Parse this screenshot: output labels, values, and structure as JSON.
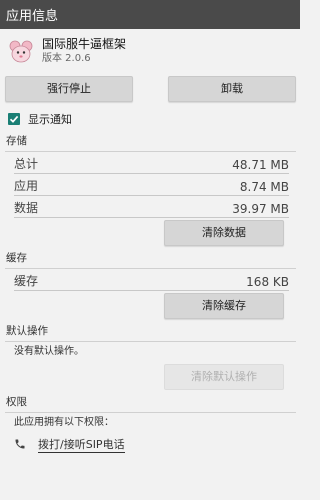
{
  "window": {
    "title": "应用信息"
  },
  "app": {
    "name": "国际服牛逼框架",
    "version": "版本 2.0.6"
  },
  "buttons": {
    "force_stop": "强行停止",
    "uninstall": "卸载"
  },
  "notifications": {
    "label": "显示通知",
    "checked": true
  },
  "storage": {
    "header": "存储",
    "rows": [
      {
        "label": "总计",
        "value": "48.71 MB"
      },
      {
        "label": "应用",
        "value": "8.74 MB"
      },
      {
        "label": "数据",
        "value": "39.97 MB"
      }
    ],
    "clear_button": "清除数据"
  },
  "cache": {
    "header": "缓存",
    "row": {
      "label": "缓存",
      "value": "168 KB"
    },
    "clear_button": "清除缓存"
  },
  "defaults": {
    "header": "默认操作",
    "text": "没有默认操作。",
    "clear_button": "清除默认操作"
  },
  "permissions": {
    "header": "权限",
    "text": "此应用拥有以下权限：",
    "items": [
      {
        "icon": "phone-icon",
        "label": "拨打/接听SIP电话"
      }
    ]
  },
  "colors": {
    "titlebar": "#4a4a4a",
    "checkbox": "#1a7f75",
    "background": "#f2f2f2"
  }
}
